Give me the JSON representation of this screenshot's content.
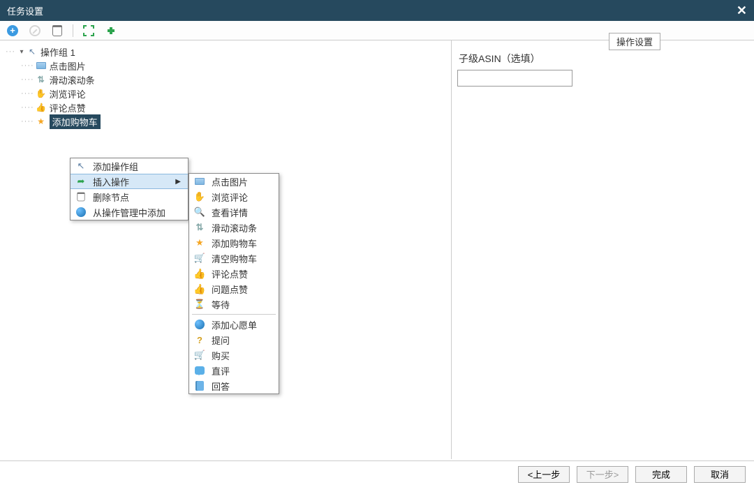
{
  "window": {
    "title": "任务设置",
    "close": "✕"
  },
  "toolbar": {},
  "tree": {
    "root": "操作组 1",
    "items": [
      {
        "label": "点击图片"
      },
      {
        "label": "滑动滚动条"
      },
      {
        "label": "浏览评论"
      },
      {
        "label": "评论点赞"
      },
      {
        "label": "添加购物车"
      }
    ]
  },
  "context_menu_1": {
    "items": [
      {
        "label": "添加操作组"
      },
      {
        "label": "插入操作",
        "submenu": true
      },
      {
        "label": "删除节点"
      },
      {
        "label": "从操作管理中添加"
      }
    ]
  },
  "context_menu_2": {
    "groups": [
      [
        {
          "label": "点击图片"
        },
        {
          "label": "浏览评论"
        },
        {
          "label": "查看详情"
        },
        {
          "label": "滑动滚动条"
        },
        {
          "label": "添加购物车"
        },
        {
          "label": "清空购物车"
        },
        {
          "label": "评论点赞"
        },
        {
          "label": "问题点赞"
        },
        {
          "label": "等待"
        }
      ],
      [
        {
          "label": "添加心愿单"
        },
        {
          "label": "提问"
        },
        {
          "label": "购买"
        },
        {
          "label": "直评"
        },
        {
          "label": "回答"
        }
      ]
    ]
  },
  "right_panel": {
    "tab": "操作设置",
    "field_label": "子级ASIN（选填）",
    "field_value": ""
  },
  "footer": {
    "prev": "<上一步",
    "next": "下一步>",
    "finish": "完成",
    "cancel": "取消"
  }
}
